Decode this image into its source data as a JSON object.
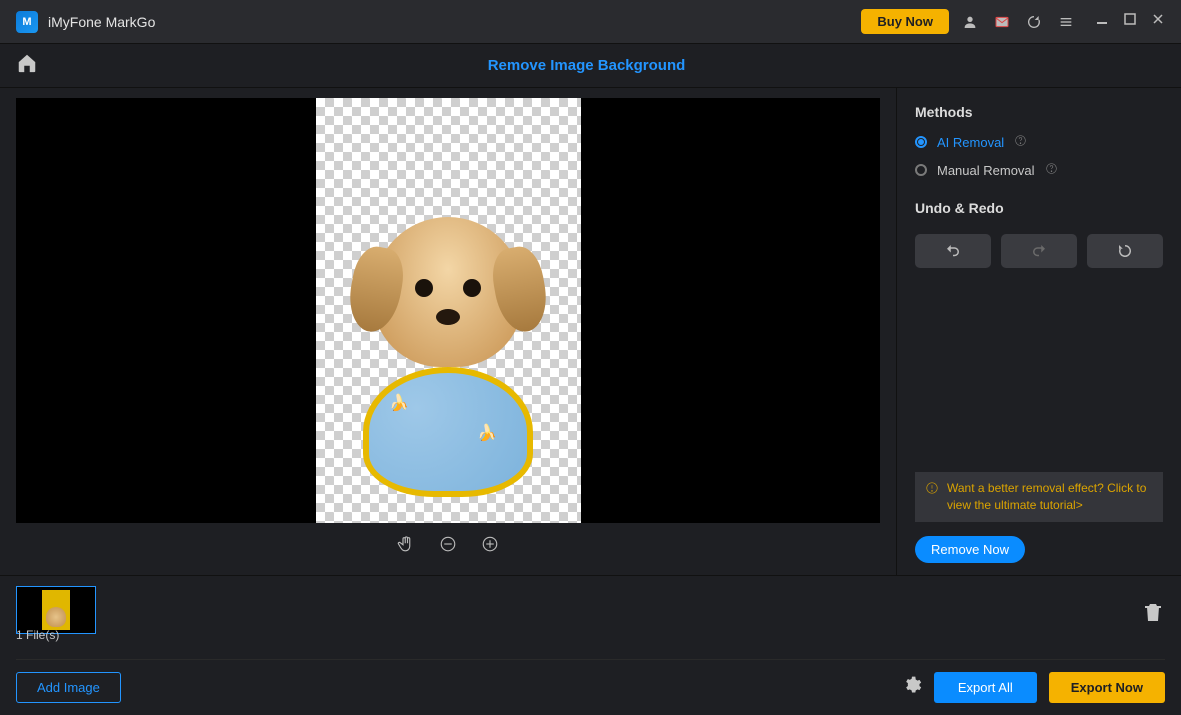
{
  "titlebar": {
    "app_name": "iMyFone MarkGo",
    "buy_now": "Buy Now"
  },
  "toolbar": {
    "page_title": "Remove Image Background"
  },
  "side": {
    "methods_label": "Methods",
    "ai_removal": "AI Removal",
    "manual_removal": "Manual Removal",
    "undo_redo_label": "Undo & Redo"
  },
  "tip": "Want a better removal effect? Click to view the ultimate tutorial>",
  "remove_now": "Remove Now",
  "bottom": {
    "file_count": "1 File(s)",
    "add_image": "Add Image",
    "export_all": "Export All",
    "export_now": "Export Now"
  }
}
